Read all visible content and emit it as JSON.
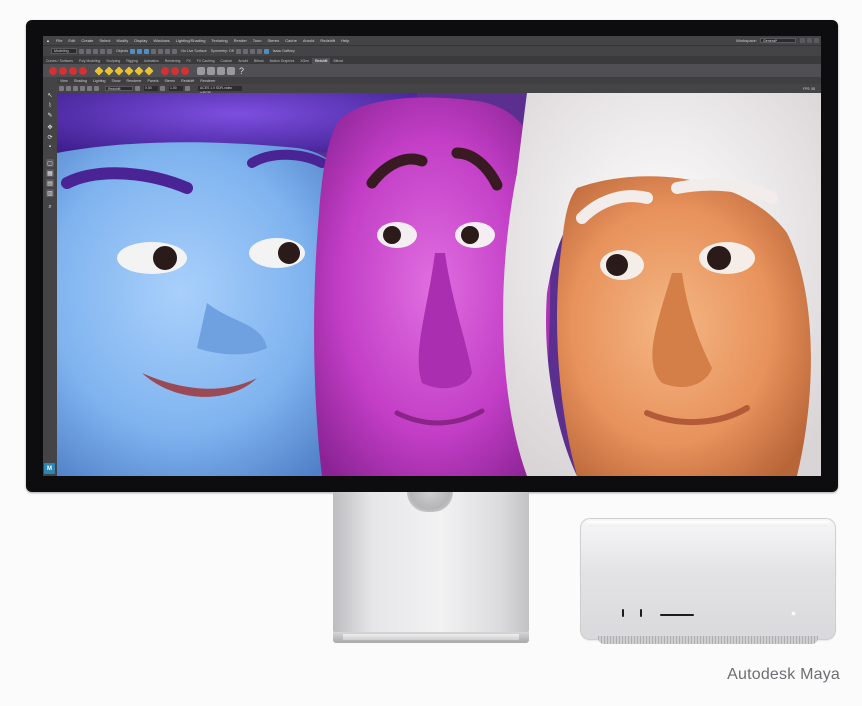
{
  "maya": {
    "menubar": {
      "items": [
        "File",
        "Edit",
        "Create",
        "Select",
        "Modify",
        "Display",
        "Windows",
        "Lighting/Shading",
        "Texturing",
        "Render",
        "Toon",
        "Stereo",
        "Cache",
        "Arnold",
        "Redshift",
        "Help"
      ],
      "workspace_label": "Workspace:",
      "workspace_value": "General*"
    },
    "statusline": {
      "mode": "Modeling",
      "object_label": "Objects",
      "live_surface": "No Live Surface",
      "symmetry": "Symmetry: Off",
      "sign_in": "Isaac Gaffney"
    },
    "shelf_tabs": [
      "Curves / Surfaces",
      "Poly Modeling",
      "Sculpting",
      "Rigging",
      "Animation",
      "Rendering",
      "FX",
      "FX Caching",
      "Custom",
      "Arnold",
      "Bifrost",
      "Motion Graphics",
      "XGen",
      "Redshift",
      "Bifrost"
    ],
    "active_shelf_tab": 13,
    "panel_menu": [
      "View",
      "Shading",
      "Lighting",
      "Show",
      "Renderer",
      "Panels",
      "Stereo",
      "Redshift",
      "Renderer"
    ],
    "panel_tools": {
      "camera": "Redshift",
      "near_value": "0.00",
      "far_value": "1.00",
      "info": "ACES 1.0 SDR-video (sRGB)",
      "fps": "FPS: 58"
    },
    "viewport_colors": {
      "background": "#6a3a9c",
      "left_face": "#7fb3ef",
      "middle_face": "#c23ec6",
      "right_face": "#e8925c",
      "hair_left": "#5a2fb5",
      "hair_right": "#f4f1f2"
    }
  },
  "caption": "Autodesk Maya"
}
